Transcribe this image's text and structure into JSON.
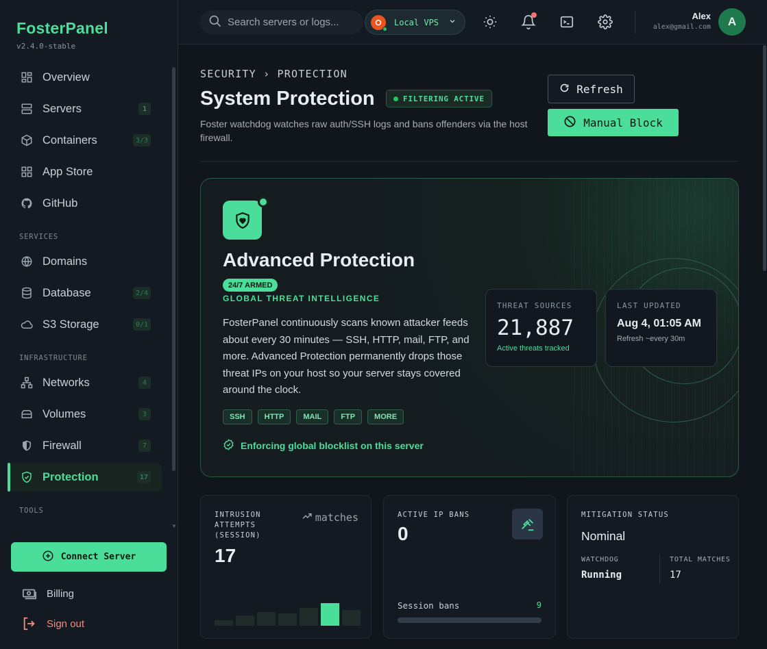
{
  "app": {
    "name": "FosterPanel",
    "version": "v2.4.0-stable"
  },
  "nav": {
    "main": [
      {
        "label": "Overview",
        "icon": "overview-icon",
        "badge": ""
      },
      {
        "label": "Servers",
        "icon": "servers-icon",
        "badge": "1"
      },
      {
        "label": "Containers",
        "icon": "containers-icon",
        "badge": "3/3"
      },
      {
        "label": "App Store",
        "icon": "app-store-icon",
        "badge": ""
      },
      {
        "label": "GitHub",
        "icon": "github-icon",
        "badge": ""
      }
    ],
    "services_title": "SERVICES",
    "services": [
      {
        "label": "Domains",
        "icon": "globe-icon",
        "badge": ""
      },
      {
        "label": "Database",
        "icon": "database-icon",
        "badge": "2/4"
      },
      {
        "label": "S3 Storage",
        "icon": "cloud-icon",
        "badge": "0/1"
      }
    ],
    "infra_title": "INFRASTRUCTURE",
    "infra": [
      {
        "label": "Networks",
        "icon": "network-icon",
        "badge": "4"
      },
      {
        "label": "Volumes",
        "icon": "volume-icon",
        "badge": "3"
      },
      {
        "label": "Firewall",
        "icon": "shield-icon",
        "badge": "7"
      },
      {
        "label": "Protection",
        "icon": "shield-check-icon",
        "badge": "17",
        "active": true
      }
    ],
    "tools_title": "TOOLS"
  },
  "sidebar_footer": {
    "connect_label": "Connect Server",
    "billing_label": "Billing",
    "signout_label": "Sign out"
  },
  "topbar": {
    "search_placeholder": "Search servers or logs...",
    "server_label": "Local VPS",
    "user_name": "Alex",
    "user_email": "alex@gmail.com",
    "avatar_letter": "A"
  },
  "header": {
    "breadcrumb": "SECURITY › PROTECTION",
    "title": "System Protection",
    "status": "FILTERING ACTIVE",
    "subtitle": "Foster watchdog watches raw auth/SSH logs and bans offenders via the host firewall.",
    "refresh_label": "Refresh",
    "block_label": "Manual Block"
  },
  "hero": {
    "title": "Advanced Protection",
    "armed": "24/7 ARMED",
    "intel": "GLOBAL THREAT INTELLIGENCE",
    "text": "FosterPanel continuously scans known attacker feeds about every 30 minutes — SSH, HTTP, mail, FTP, and more. Advanced Protection permanently drops those threat IPs on your host so your server stays covered around the clock.",
    "tags": [
      "SSH",
      "HTTP",
      "MAIL",
      "FTP",
      "MORE"
    ],
    "enforce": "Enforcing global blocklist on this server",
    "sources_label": "THREAT SOURCES",
    "sources_value": "21,887",
    "sources_note": "Active threats tracked",
    "updated_label": "LAST UPDATED",
    "updated_value": "Aug 4, 01:05 AM",
    "updated_note": "Refresh ~every 30m"
  },
  "stats": {
    "intrusion_label": "INTRUSION ATTEMPTS (SESSION)",
    "intrusion_value": "17",
    "matches_label": "matches",
    "intrusion_spark": [
      0.2,
      0.38,
      0.5,
      0.46,
      0.66,
      0.82,
      0.58
    ],
    "bans_label": "ACTIVE IP BANS",
    "bans_value": "0",
    "session_label": "Session bans",
    "session_value": "9",
    "mitigation_label": "MITIGATION STATUS",
    "mitigation_value": "Nominal",
    "watchdog_label": "WATCHDOG",
    "watchdog_value": "Running",
    "total_label": "TOTAL MATCHES",
    "total_value": "17"
  },
  "colors": {
    "accent": "#4ade9a",
    "background": "#11161d",
    "sidebar": "#141a22",
    "danger": "#f28b82"
  }
}
